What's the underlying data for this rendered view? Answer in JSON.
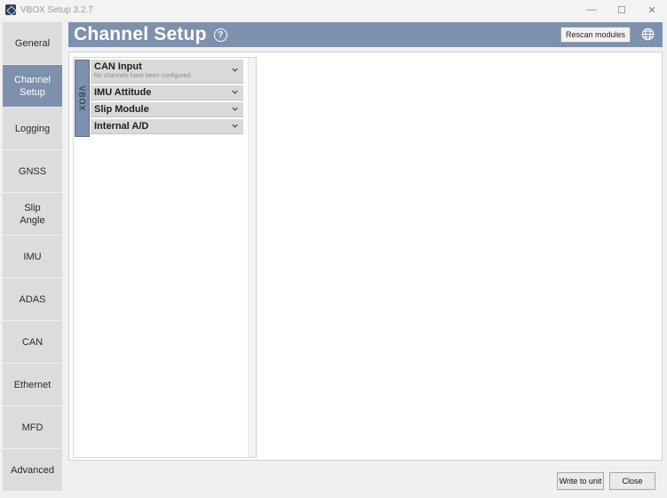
{
  "window": {
    "title": "VBOX Setup 3.2.7",
    "controls": [
      "—",
      "☐",
      "✕"
    ]
  },
  "sidebar": {
    "items": [
      {
        "label": "General",
        "active": false
      },
      {
        "label": "Channel\nSetup",
        "active": true
      },
      {
        "label": "Logging",
        "active": false
      },
      {
        "label": "GNSS",
        "active": false
      },
      {
        "label": "Slip\nAngle",
        "active": false
      },
      {
        "label": "IMU",
        "active": false
      },
      {
        "label": "ADAS",
        "active": false
      },
      {
        "label": "CAN",
        "active": false
      },
      {
        "label": "Ethernet",
        "active": false
      },
      {
        "label": "MFD",
        "active": false
      },
      {
        "label": "Advanced",
        "active": false
      }
    ]
  },
  "header": {
    "title": "Channel Setup",
    "help_glyph": "?",
    "rescan_label": "Rescan modules",
    "globe_icon": "globe-icon"
  },
  "panel": {
    "tab_label": "VBOX",
    "sections": [
      {
        "title": "CAN Input",
        "subtitle": "No channels have been configured."
      },
      {
        "title": "IMU Attitude",
        "subtitle": ""
      },
      {
        "title": "Slip Module",
        "subtitle": ""
      },
      {
        "title": "Internal A/D",
        "subtitle": ""
      }
    ]
  },
  "footer": {
    "write_label": "Write to unit",
    "close_label": "Close"
  },
  "colors": {
    "accent": "#7d90ad",
    "section_bg": "#d9d9d9"
  }
}
